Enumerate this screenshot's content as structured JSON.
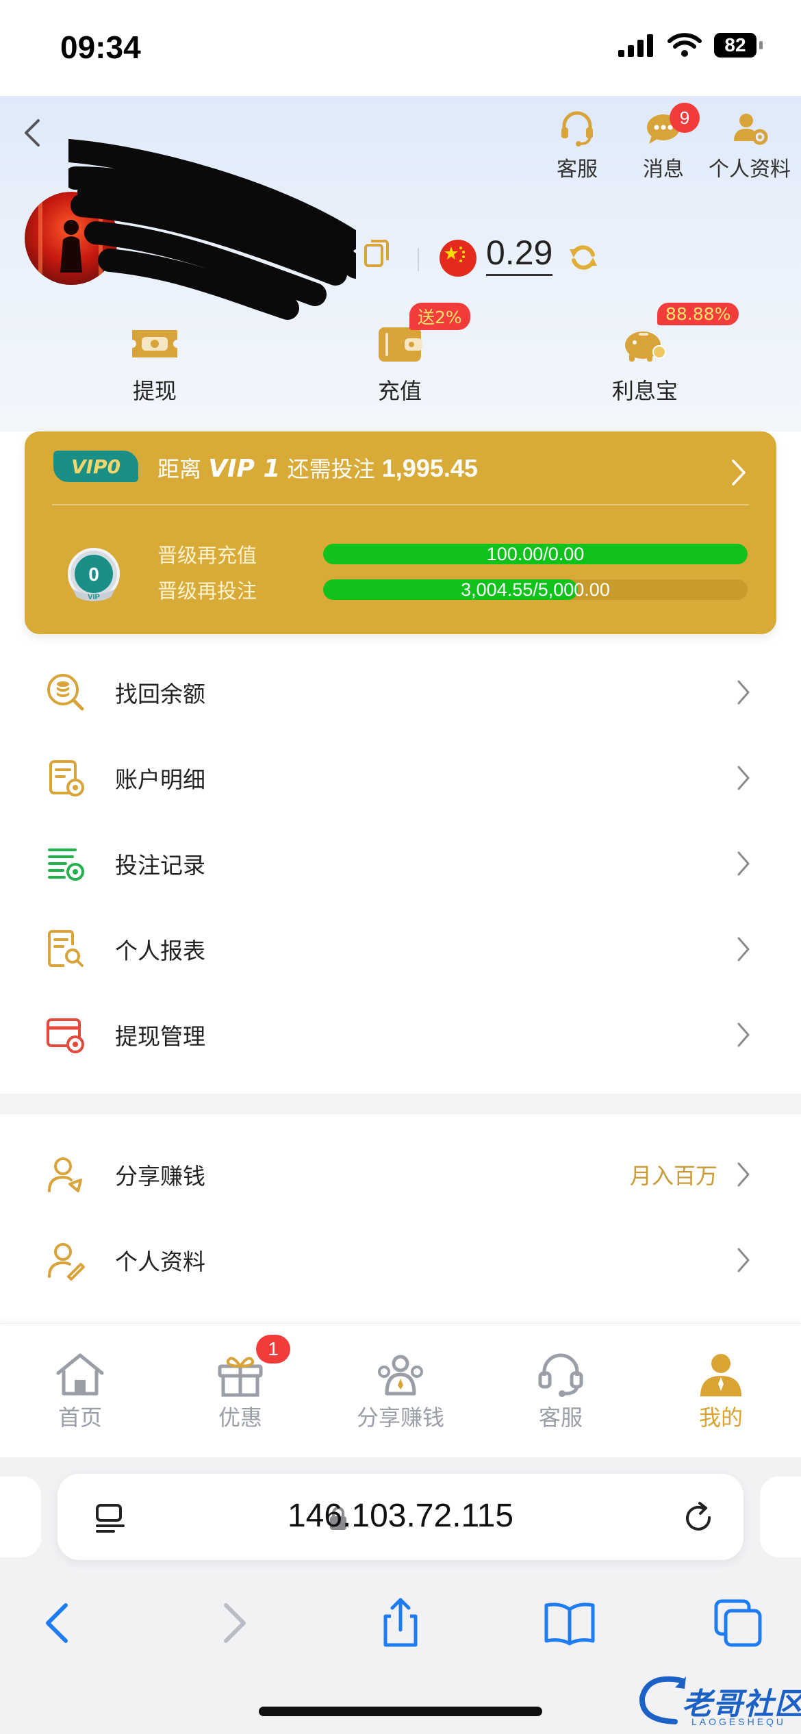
{
  "status": {
    "time": "09:34",
    "battery": "82"
  },
  "header": {
    "top_actions": [
      {
        "label": "客服",
        "icon": "headset-icon"
      },
      {
        "label": "消息",
        "icon": "chat-bubble-icon",
        "badge": "9"
      },
      {
        "label": "个人资料",
        "icon": "user-settings-icon"
      }
    ],
    "balance": "0.29",
    "actions": [
      {
        "label": "提现",
        "icon": "withdraw-ticket-icon"
      },
      {
        "label": "充值",
        "icon": "wallet-icon",
        "badge": "送2%"
      },
      {
        "label": "利息宝",
        "icon": "piggy-bank-icon",
        "badge": "88.88%"
      }
    ]
  },
  "vip": {
    "tag": "VIP0",
    "prefix": "距离",
    "next_level": "VIP 1",
    "middle": "还需投注",
    "amount": "1,995.45",
    "badge_level": "0",
    "badge_text": "VIP",
    "progress": [
      {
        "label": "晋级再充值",
        "text": "100.00/0.00",
        "fill": 1.0
      },
      {
        "label": "晋级再投注",
        "text": "3,004.55/5,000.00",
        "fill": 0.6
      }
    ]
  },
  "menu": [
    {
      "label": "找回余额",
      "icon": "balance-search-icon"
    },
    {
      "label": "账户明细",
      "icon": "account-detail-icon"
    },
    {
      "label": "投注记录",
      "icon": "bet-record-icon"
    },
    {
      "label": "个人报表",
      "icon": "report-search-icon"
    },
    {
      "label": "提现管理",
      "icon": "withdraw-settings-icon"
    }
  ],
  "menu2": [
    {
      "label": "分享赚钱",
      "icon": "share-user-icon",
      "extra": "月入百万"
    },
    {
      "label": "个人资料",
      "icon": "edit-user-icon"
    }
  ],
  "tabs": [
    {
      "label": "首页",
      "icon": "home-icon"
    },
    {
      "label": "优惠",
      "icon": "gift-icon",
      "badge": "1"
    },
    {
      "label": "分享赚钱",
      "icon": "share-people-icon"
    },
    {
      "label": "客服",
      "icon": "headset-icon"
    },
    {
      "label": "我的",
      "icon": "profile-icon",
      "active": true
    }
  ],
  "browser": {
    "url": "146.103.72.115"
  },
  "watermark": {
    "text": "老哥社区",
    "sub": "LAOGESHEQU"
  },
  "colors": {
    "gold": "#D8AB38",
    "progress_green": "#11C21C",
    "badge_red": "#F23C3C",
    "safari_blue": "#1E7CF2"
  }
}
